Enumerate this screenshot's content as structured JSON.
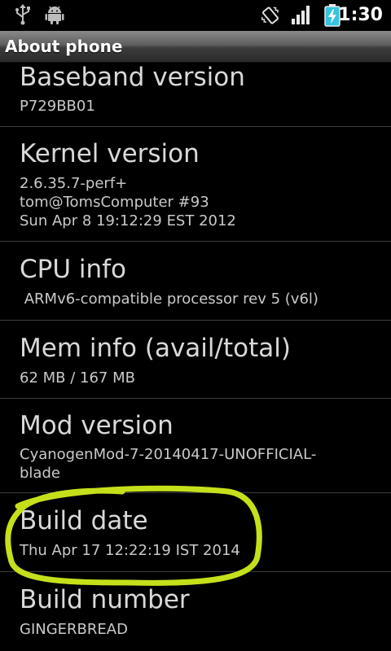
{
  "status_bar": {
    "time": "1:30",
    "icons": [
      "usb-icon",
      "android-debug-icon",
      "vibrate-icon",
      "signal-icon",
      "battery-charging-icon"
    ]
  },
  "title_bar": {
    "title": "About phone"
  },
  "items": [
    {
      "title": "Baseband version",
      "summary": "P729BB01"
    },
    {
      "title": "Kernel version",
      "summary": "2.6.35.7-perf+\ntom@TomsComputer #93\nSun Apr 8 19:12:29 EST 2012"
    },
    {
      "title": "CPU info",
      "summary": " ARMv6-compatible processor rev 5 (v6l)"
    },
    {
      "title": "Mem info (avail/total)",
      "summary": "62 MB / 167 MB"
    },
    {
      "title": "Mod version",
      "summary": "CyanogenMod-7-20140417-UNOFFICIAL-\nblade"
    },
    {
      "title": "Build date",
      "summary": "Thu Apr 17 12:22:19 IST 2014"
    },
    {
      "title": "Build number",
      "summary": "GINGERBREAD"
    }
  ],
  "colors": {
    "highlight": "#c5e01a",
    "background": "#000000",
    "divider": "#3d3d3d"
  }
}
